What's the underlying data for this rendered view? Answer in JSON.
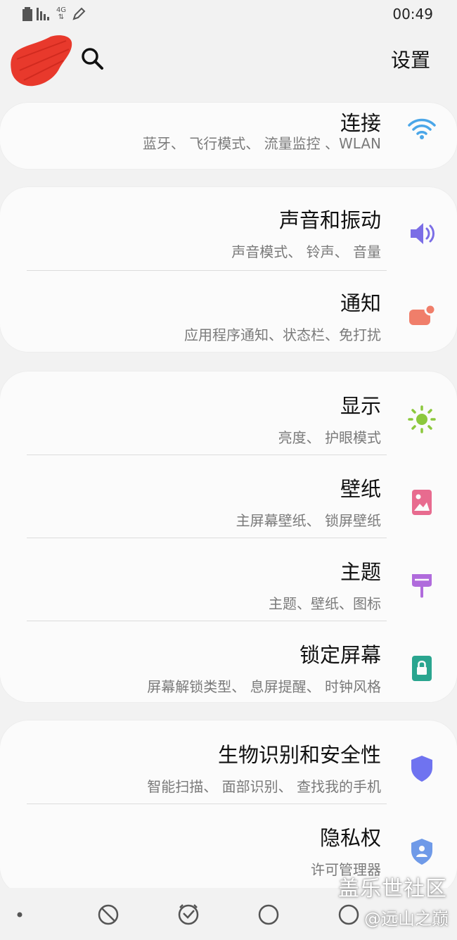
{
  "status_bar": {
    "time": "00:49",
    "network": "4G",
    "icons": [
      "battery-icon",
      "signal-icon",
      "network-4g-icon",
      "edit-icon"
    ]
  },
  "header": {
    "title": "设置",
    "search_icon": "search-icon",
    "avatar_color": "#e8392c"
  },
  "sections": [
    {
      "items": [
        {
          "title": "连接",
          "subtitle": "蓝牙、 飞行模式、 流量监控 、WLAN",
          "icon": "wifi-icon",
          "color": "#4aa6e8"
        }
      ]
    },
    {
      "items": [
        {
          "title": "声音和振动",
          "subtitle": "声音模式、 铃声、 音量",
          "icon": "volume-icon",
          "color": "#7b6ee6"
        },
        {
          "title": "通知",
          "subtitle": "应用程序通知、状态栏、免打扰",
          "icon": "notification-icon",
          "color": "#f07e6a"
        }
      ]
    },
    {
      "items": [
        {
          "title": "显示",
          "subtitle": "亮度、 护眼模式",
          "icon": "brightness-icon",
          "color": "#8cc83c"
        },
        {
          "title": "壁纸",
          "subtitle": "主屏幕壁纸、 锁屏壁纸",
          "icon": "wallpaper-icon",
          "color": "#e86b8f"
        },
        {
          "title": "主题",
          "subtitle": "主题、壁纸、图标",
          "icon": "theme-brush-icon",
          "color": "#b06bdc"
        },
        {
          "title": "锁定屏幕",
          "subtitle": "屏幕解锁类型、 息屏提醒、 时钟风格",
          "icon": "lock-icon",
          "color": "#2aa58f"
        }
      ]
    },
    {
      "items": [
        {
          "title": "生物识别和安全性",
          "subtitle": "智能扫描、 面部识别、 查找我的手机",
          "icon": "shield-icon",
          "color": "#6f73f0"
        },
        {
          "title": "隐私权",
          "subtitle": "许可管理器",
          "icon": "privacy-shield-icon",
          "color": "#6f9ae8"
        }
      ]
    }
  ],
  "nav_bar": {
    "buttons": [
      "dot-icon",
      "block-icon",
      "clock-check-icon",
      "home-circle-icon",
      "back-icon"
    ]
  },
  "watermark": {
    "line1": "盖乐世社区",
    "line2": "@远山之巅"
  }
}
